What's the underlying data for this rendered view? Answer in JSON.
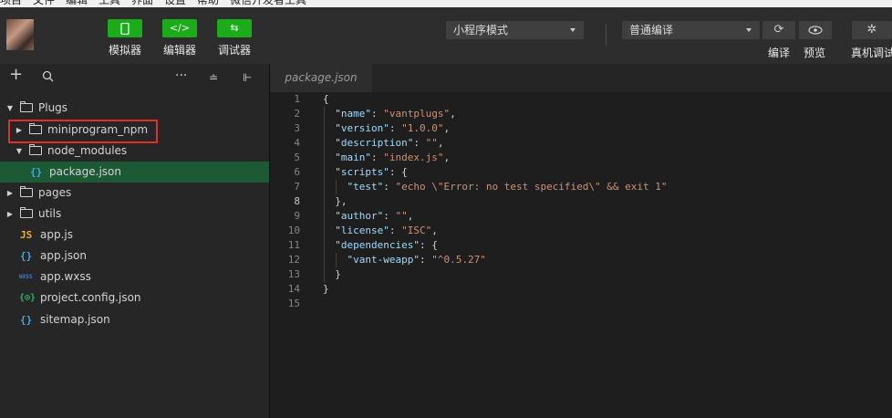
{
  "menu": [
    "项目",
    "文件",
    "编辑",
    "工具",
    "界面",
    "设置",
    "帮助",
    "微信开发者工具"
  ],
  "toolbar": {
    "simulator_label": "模拟器",
    "editor_label": "编辑器",
    "debugger_label": "调试器",
    "mode_select": "小程序模式",
    "compile_select": "普通编译",
    "compile_label": "编译",
    "preview_label": "预览",
    "remote_debug_label": "真机调试"
  },
  "sidebar": {
    "tree": [
      {
        "label": "Plugs",
        "type": "folder",
        "expanded": true
      },
      {
        "label": "miniprogram_npm",
        "type": "folder",
        "expanded": false
      },
      {
        "label": "node_modules",
        "type": "folder",
        "expanded": false
      },
      {
        "label": "package.json",
        "type": "json",
        "selected": true
      },
      {
        "label": "pages",
        "type": "folder",
        "expanded": false
      },
      {
        "label": "utils",
        "type": "folder",
        "expanded": false
      },
      {
        "label": "app.js",
        "type": "js"
      },
      {
        "label": "app.json",
        "type": "json"
      },
      {
        "label": "app.wxss",
        "type": "wxss"
      },
      {
        "label": "project.config.json",
        "type": "config"
      },
      {
        "label": "sitemap.json",
        "type": "json"
      }
    ]
  },
  "editor": {
    "tab_label": "package.json",
    "line_numbers": [
      "1",
      "2",
      "3",
      "4",
      "5",
      "6",
      "7",
      "8",
      "9",
      "10",
      "11",
      "12",
      "13",
      "14",
      "15"
    ],
    "active_line": "8",
    "lines": [
      "{",
      "  \"name\": \"vantplugs\",",
      "  \"version\": \"1.0.0\",",
      "  \"description\": \"\",",
      "  \"main\": \"index.js\",",
      "  \"scripts\": {",
      "    \"test\": \"echo \\\"Error: no test specified\\\" && exit 1\"",
      "  },",
      "  \"author\": \"\",",
      "  \"license\": \"ISC\",",
      "  \"dependencies\": {",
      "    \"vant-weapp\": \"^0.5.27\"",
      "  }",
      "}",
      ""
    ]
  },
  "icons": {
    "simulator": "phone-icon",
    "editor": "code-icon",
    "debugger": "debug-icon",
    "compile": "refresh-icon",
    "preview": "eye-icon",
    "remote_debug": "bug-icon"
  },
  "colors": {
    "accent": "#1aad19",
    "selected_row": "#1e5936",
    "highlight_box": "#e0302a",
    "json_key": "#9cdcfe",
    "json_string": "#ce9178"
  }
}
